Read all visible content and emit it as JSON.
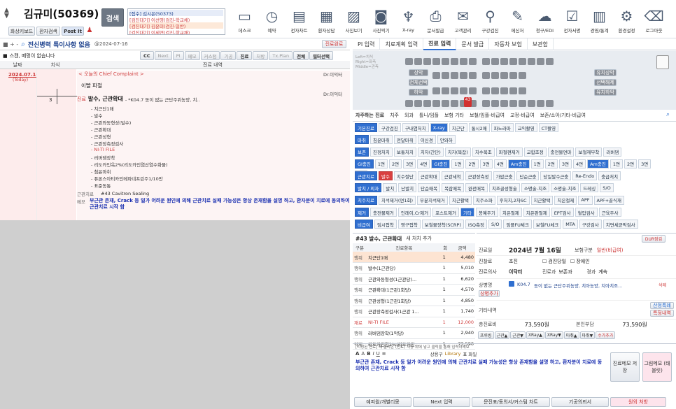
{
  "patient": {
    "name": "김규미(50369)",
    "search_label": "검색"
  },
  "top_buttons": [
    "화상키보드",
    "환자검색",
    "Post It"
  ],
  "waiting_list": [
    "[접수] 김시은(50373)",
    "[검진대기] 이선영(검진-학교채)",
    "[검진대기] 김윤미(검진-일반)",
    "[검진대기] 이세연(검진-학교채)"
  ],
  "toolbar": [
    {
      "label": "데스크",
      "icon": "monitor-icon"
    },
    {
      "label": "예약",
      "icon": "clock-icon"
    },
    {
      "label": "전자차트",
      "icon": "document-icon"
    },
    {
      "label": "환자상담",
      "icon": "film-icon"
    },
    {
      "label": "사진보기",
      "icon": "photo-icon"
    },
    {
      "label": "사진찍기",
      "icon": "camera-icon"
    },
    {
      "label": "X-ray",
      "icon": "tooth-icon"
    },
    {
      "label": "문서발급",
      "icon": "printer-icon"
    },
    {
      "label": "고객관리",
      "icon": "mail-icon"
    },
    {
      "label": "구강검진",
      "icon": "probe-icon"
    },
    {
      "label": "메신저",
      "icon": "chat-icon"
    },
    {
      "label": "청구/EDI",
      "icon": "cloud-icon"
    },
    {
      "label": "전자서명",
      "icon": "checkbox-icon"
    },
    {
      "label": "경영/통계",
      "icon": "chart-icon"
    },
    {
      "label": "환경설정",
      "icon": "gear-icon"
    },
    {
      "label": "로그아웃",
      "icon": "trash-icon"
    }
  ],
  "chart": {
    "header": "전신병력 특이사항 없음",
    "header_date": "@2024-07-16",
    "done_button": "진료완료",
    "note": "스캔, 메멍이 없습니다",
    "filters": [
      "CC",
      "Next",
      "PI",
      "메모",
      "커스텀",
      "기공",
      "진료",
      "처방",
      "Tx.Plan",
      "전체",
      "필터선택"
    ],
    "col_date": "날짜",
    "col_tooth": "치식",
    "col_content": "진료 내역",
    "visit_date": "2024.07.16",
    "visit_today": "(Today)",
    "cc_title": "< 오늘의 Chief Complaint >",
    "cc_text": "이빨 파절",
    "doctor": "Dr.이익터",
    "doctor2": "Dr.이익터",
    "tooth_num": "3",
    "tx_label": "진료",
    "tx_title": "발수, 근관확대",
    "tx_diag": "- *K04.7 동이 없는 근단주위농양, 치..",
    "tx_items": [
      "- 치근단1매",
      "- 발수",
      "- 근관와동형성(발수)",
      "- 근관확대",
      "- 근관성형",
      "- 근관장측정검사",
      "- NI-TI FILE",
      "- 러버댐장착",
      "- 리도카인옥2%(리도카인염산염수화물)",
      "- 침윤마취",
      "- 퓨론스아티카인메파네프린주1/10만",
      "- 표준동통"
    ],
    "tooth_note_label": "근관치료",
    "tooth_note": "#43 Cavitron Sealing",
    "memo_label": "메모",
    "memo": "부근관 존재, Crack 등 일가 어려운 원인에 의해 근관치료 실패 가능성은 항상 존재함을 설명 하고, 환자분이 치료에 동의하여 근관치료 시작 함"
  },
  "right_tabs": [
    "PI 입력",
    "치료계획 입력",
    "진료 입력",
    "문서 발급",
    "자동차 보험",
    "보관함"
  ],
  "tooth_labels": [
    "상악",
    "전체선택",
    "하악",
    "유치상악",
    "선택해제",
    "유치하악"
  ],
  "selected_tooth": "43",
  "category_tabs": [
    "자주하는 진료",
    "치주",
    "외과",
    "틀니/임플",
    "보험 기타",
    "보철/임플-비급여",
    "교정-비급여",
    "보존/소아/기타-비급여"
  ],
  "proc_rows": [
    [
      "기본진료",
      "구강검진",
      "구내염처치",
      "X-ray",
      "치근단",
      "통시2매",
      "파노라마",
      "교익촬영",
      "CT촬영"
    ],
    [
      "마취",
      "침윤마취",
      "전달마취",
      "이신경",
      "안와하"
    ],
    [
      "보존",
      "진정처치",
      "보통처치",
      "치자(간단)",
      "치자(복잡)",
      "치수복조",
      "파절편제거",
      "교합조정",
      "충전물연마",
      "보철재부착",
      "러버댐"
    ],
    [
      "GI충진",
      "1면",
      "2면",
      "3면",
      "4면",
      "GI충진",
      "1면",
      "2면",
      "3면",
      "4면",
      "Am충진",
      "1면",
      "2면",
      "3면",
      "4면",
      "Am충진",
      "1면",
      "2면",
      "3면",
      "4면"
    ],
    [
      "근관치료",
      "발수",
      "치수절단",
      "근관확대",
      "근관세척",
      "근관장측정",
      "가압근충",
      "단순근충",
      "당일발수근충",
      "Re-Endo",
      "충급처치"
    ],
    [
      "발치 / 외과",
      "발치",
      "난발치",
      "단순매복",
      "복잡매복",
      "완전매복",
      "치조골성형술",
      "소명술-치조",
      "소명술-치조",
      "드레싱",
      "S/O"
    ],
    [
      "치주치료",
      "치석제거(연1회)",
      "부분치석제거",
      "치근활택",
      "치주소파",
      "후처치,2차SC",
      "치근활택",
      "치은절제",
      "APF",
      "APF+골식재"
    ],
    [
      "제거",
      "충전물제거",
      "인레이,Cr제거",
      "포스트제거",
      "기타",
      "봉예주기",
      "치은절제",
      "치은판절제",
      "EPT검사",
      "혈압검사",
      "근육주사"
    ],
    [
      "비급여",
      "임시접착",
      "영구접착",
      "보철물장착(SCRP)",
      "ISQ측정",
      "S/O",
      "임플FU체크",
      "보철FU체크",
      "MTA",
      "구강검사",
      "치면세균막검사"
    ]
  ],
  "proc_table": {
    "title": "#43 발수, 근관확대",
    "add": "새 처치 추가",
    "headers": [
      "구분",
      "진료항목",
      "회",
      "금액"
    ],
    "rows": [
      [
        "행위",
        "치근단1매",
        "1",
        "4,480"
      ],
      [
        "행위",
        "발수(1근관당)",
        "1",
        "5,010"
      ],
      [
        "행위",
        "근관와동형성(1근관당)...",
        "1",
        "6,620"
      ],
      [
        "행위",
        "근관확대(1근관1회당)",
        "1",
        "4,570"
      ],
      [
        "행위",
        "근관성형(1근관1회당)",
        "1",
        "4,850"
      ],
      [
        "행위",
        "근관장측정검사(1근관 1...",
        "1",
        "1,740"
      ],
      [
        "재료",
        "NI-TI FILE",
        "1",
        "12,000"
      ],
      [
        "행위",
        "러버댐장착(1악당)",
        "1",
        "2,940"
      ],
      [
        "약제",
        "리도카인염2%(리도카인...",
        "1",
        "73,590"
      ]
    ]
  },
  "form": {
    "date_label": "진료일",
    "date": "2024년 7월 16일",
    "insurance_label": "보험구분",
    "insurance": "일반(비급여)",
    "type_label": "진찰료",
    "type": "초진",
    "check1": "검진당일",
    "check2": "장애인",
    "doctor_label": "진료의사",
    "doctor": "이닥터",
    "dept_label": "진료과",
    "dept": "보존과",
    "route_label": "경과",
    "route": "계속",
    "diag_label": "상병명",
    "diag_code": "K04.7",
    "diag_text": "동이 없는 근단주위농양, 치아농양, 치아치조...",
    "diag_btn": "상병추가",
    "diag_del": "삭제",
    "other_label": "기타내역",
    "special_btn": "산정특례",
    "special_btn2": "특정내역",
    "total_label": "총진료비",
    "total": "73,590원",
    "self_label": "본인부담",
    "self": "73,590원",
    "small_buttons": [
      "프루빙",
      "근관▲",
      "근관▼",
      "XRay▲",
      "XRay▼",
      "마취▲",
      "마취▼",
      "수가추가"
    ]
  },
  "editor": {
    "hint": "[지정된 진료] 에 올라온 (진료) 처방 뒤에 넣고 클릭을 통해 입력하세요",
    "toolbar_extra": [
      "상용구",
      "Library",
      "표 파일"
    ],
    "text": "부근관 존재, Crack 등 일가 어려운 원인에 의해 근관치료 실패 가능성은 항상 존재함을 설명 하고, 환자분이 치료에 동의하여 근관치료 시작 함",
    "save_memo": "진료메모 저장",
    "pic_memo": "그림메모 (태블릿)"
  },
  "bottom_buttons": [
    "예피왈/개별리몽",
    "Next 입력",
    "문진표/동의서/커스텀 차트",
    "기공의뢰서",
    "원외 처방"
  ]
}
